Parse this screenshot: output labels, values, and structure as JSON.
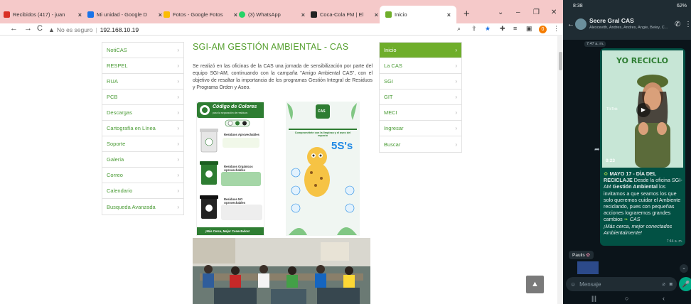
{
  "browser": {
    "tabs": [
      {
        "title": "Recibidos (417) - juan",
        "favicon_color": "#d93025"
      },
      {
        "title": "Mi unidad - Google D",
        "favicon_color": "#1a73e8"
      },
      {
        "title": "Fotos - Google Fotos",
        "favicon_color": "#fbbc04"
      },
      {
        "title": "(3) WhatsApp",
        "favicon_color": "#25d366"
      },
      {
        "title": "Coca-Cola FM | El",
        "favicon_color": "#222222"
      },
      {
        "title": "Inicio",
        "favicon_color": "#6fae2b"
      }
    ],
    "new_tab": "+",
    "win_controls": {
      "dropdown": "⌄",
      "minimize": "–",
      "maximize": "❐",
      "close": "✕"
    },
    "security_label": "No es seguro",
    "url": "192.168.10.19",
    "profile_initial": "0"
  },
  "page": {
    "left_menu": [
      "NotiCAS",
      "RESPEL",
      "RUA",
      "PCB",
      "Descargas",
      "Cartografía en Línea",
      "Soporte",
      "Galeria",
      "Correo",
      "Calendario",
      "Busqueda Avanzada"
    ],
    "right_menu": [
      "Inicio",
      "La CAS",
      "SGI",
      "GIT",
      "MECI",
      "Ingresar",
      "Buscar"
    ],
    "active_right": "Inicio",
    "title": "SGI-AM GESTIÓN AMBIENTAL - CAS",
    "body": "Se realizó en las oficinas de la CAS una jornada de sensibilización por parte del equipo SGI-AM, continuando con la campaña \"Amigo Ambiental CAS\", con el objetivo de resaltar la importancia de los programas Gestión Integral de Residuos y Programa Orden y Aseo.",
    "poster1": {
      "heading": "Código de Colores",
      "subheading": "para la separación de residuos",
      "bins": [
        {
          "label": "Residuos Aprovechables",
          "color": "#e6e6e6"
        },
        {
          "label": "Residuos Orgánicos Aprovechables",
          "color": "#2e7d32"
        },
        {
          "label": "Residuos NO Aprovechables",
          "color": "#222222"
        }
      ],
      "footer": "¡Más Cerca, Mejor Conectados!"
    },
    "poster2": {
      "logo": "CAS",
      "heading": "Comprométete con la limpieza y el aseo del espacio",
      "big": "5S's"
    }
  },
  "whatsapp": {
    "status_time": "8:38",
    "status_right": "62%",
    "group_name": "Secre Gral CAS",
    "members": "Alexcevith, Andres, Andres, Angie, Beley, C...",
    "prev_time": "7:47 a. m.",
    "video": {
      "overlay_title": "YO RECICLO",
      "duration": "0:23",
      "source": "TikTok"
    },
    "message": {
      "heading": "MAYO 17 - DÍA DEL RECICLAJE",
      "text1": " Desde la oficina SGI-AM ",
      "bold": "Gestión Ambiental",
      "text2": " los invitamos a que seamos los que solo queremos cuidar el Ambiente reciclando, pues con pequeñas acciones lograremos grandes cambios ",
      "tag": "CAS",
      "slogan": "¡Más cerca, mejor conectados Ambientalmente!",
      "time": "7:44 a. m."
    },
    "next_sender": "Paulis",
    "input_placeholder": "Mensaje"
  }
}
